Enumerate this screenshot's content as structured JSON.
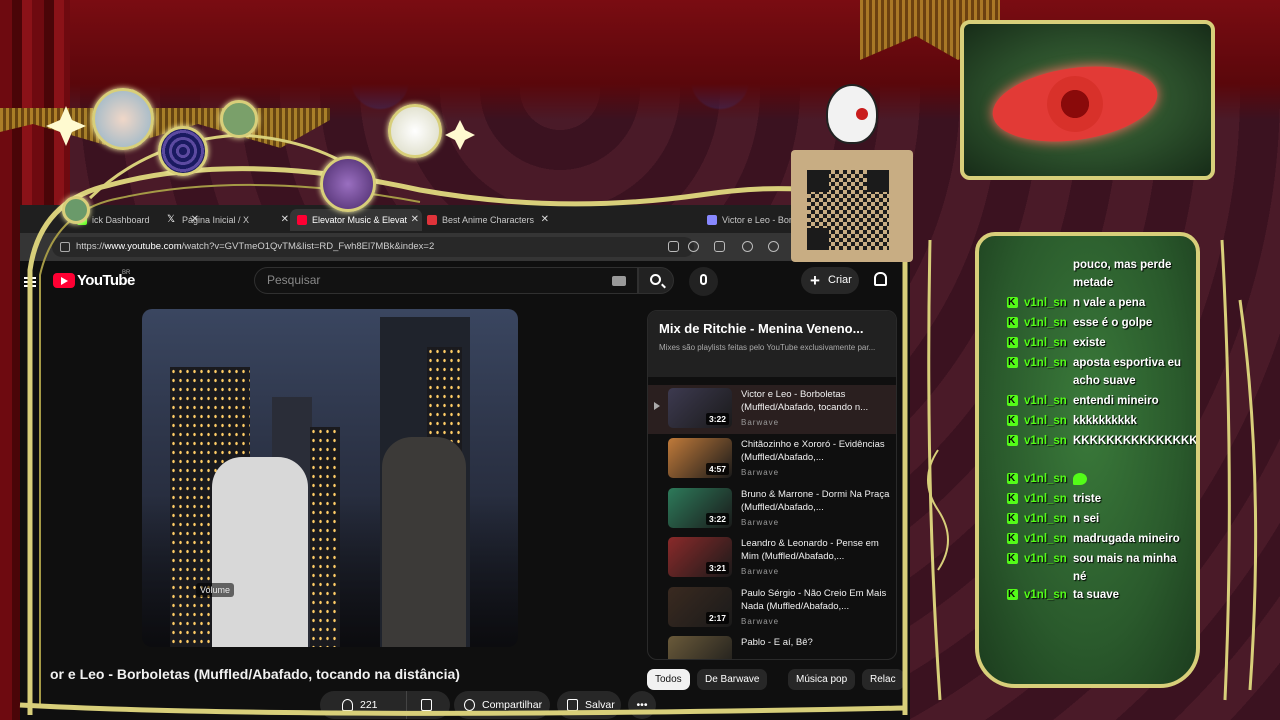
{
  "browser": {
    "tabs": [
      {
        "label": "ick Dashboard",
        "favicon_color": "#53fc18",
        "active": false
      },
      {
        "label": "Página Inicial / X",
        "favicon_color": "#ffffff",
        "active": false
      },
      {
        "label": "Elevator Music & Elevat",
        "favicon_color": "#ff0033",
        "active": true
      },
      {
        "label": "Best Anime Characters",
        "favicon_color": "#e0333a",
        "active": false
      },
      {
        "label": "Victor e Leo - Borb",
        "favicon_color": "#8888ff",
        "active": false
      }
    ],
    "url_prefix": "https://",
    "url_host": "www.youtube.com",
    "url_rest": "/watch?v=GVTmeO1QvTM&list=RD_Fwh8El7MBk&index=2"
  },
  "youtube": {
    "logo_text": "YouTube",
    "country": "BR",
    "search_placeholder": "Pesquisar",
    "create_label": "Criar",
    "video_title": "or e Leo - Borboletas (Muffled/Abafado, tocando na distância)",
    "volume_tooltip": "Volume",
    "actions": {
      "likes": "221",
      "share": "Compartilhar",
      "save": "Salvar"
    },
    "playlist": {
      "title": "Mix de Ritchie - Menina Veneno...",
      "subtitle": "Mixes são playlists feitas pelo YouTube exclusivamente par...",
      "items": [
        {
          "title": "Victor e Leo - Borboletas (Muffled/Abafado, tocando n...",
          "channel": "Barwave",
          "duration": "3:22",
          "current": true
        },
        {
          "title": "Chitãozinho e Xororó - Evidências (Muffled/Abafado,...",
          "channel": "Barwave",
          "duration": "4:57",
          "current": false
        },
        {
          "title": "Bruno & Marrone - Dormi Na Praça (Muffled/Abafado,...",
          "channel": "Barwave",
          "duration": "3:22",
          "current": false
        },
        {
          "title": "Leandro & Leonardo - Pense em Mim (Muffled/Abafado,...",
          "channel": "Barwave",
          "duration": "3:21",
          "current": false
        },
        {
          "title": "Paulo Sérgio - Não Creio Em Mais Nada (Muffled/Abafado,...",
          "channel": "Barwave",
          "duration": "2:17",
          "current": false
        },
        {
          "title": "Pablo - E aí, Bê?",
          "channel": "",
          "duration": "",
          "current": false
        }
      ]
    },
    "chips": [
      "Todos",
      "De Barwave",
      "Música pop",
      "Relac"
    ]
  },
  "chat": {
    "messages": [
      {
        "user": "",
        "text": "pouco, mas perde metade"
      },
      {
        "user": "v1nl_sn",
        "text": "n vale a pena"
      },
      {
        "user": "v1nl_sn",
        "text": "esse é o golpe"
      },
      {
        "user": "v1nl_sn",
        "text": "existe"
      },
      {
        "user": "v1nl_sn",
        "text": "aposta esportiva eu acho suave"
      },
      {
        "user": "v1nl_sn",
        "text": "entendi mineiro"
      },
      {
        "user": "v1nl_sn",
        "text": "kkkkkkkkkk"
      },
      {
        "user": "v1nl_sn",
        "text": "KKKKKKKKKKKKKKKKKKKKKK"
      },
      {
        "user": "v1nl_sn",
        "text": "",
        "emote": "kick-emote"
      },
      {
        "user": "v1nl_sn",
        "text": "triste"
      },
      {
        "user": "v1nl_sn",
        "text": "n sei"
      },
      {
        "user": "v1nl_sn",
        "text": "madrugada mineiro"
      },
      {
        "user": "v1nl_sn",
        "text": "sou mais na minha né"
      },
      {
        "user": "v1nl_sn",
        "text": "ta suave"
      }
    ]
  },
  "colors": {
    "youtube_red": "#ff0033",
    "kick_green": "#53fc18",
    "frame_gold": "#d8cf7a",
    "curtain_red": "#6e0a10"
  }
}
